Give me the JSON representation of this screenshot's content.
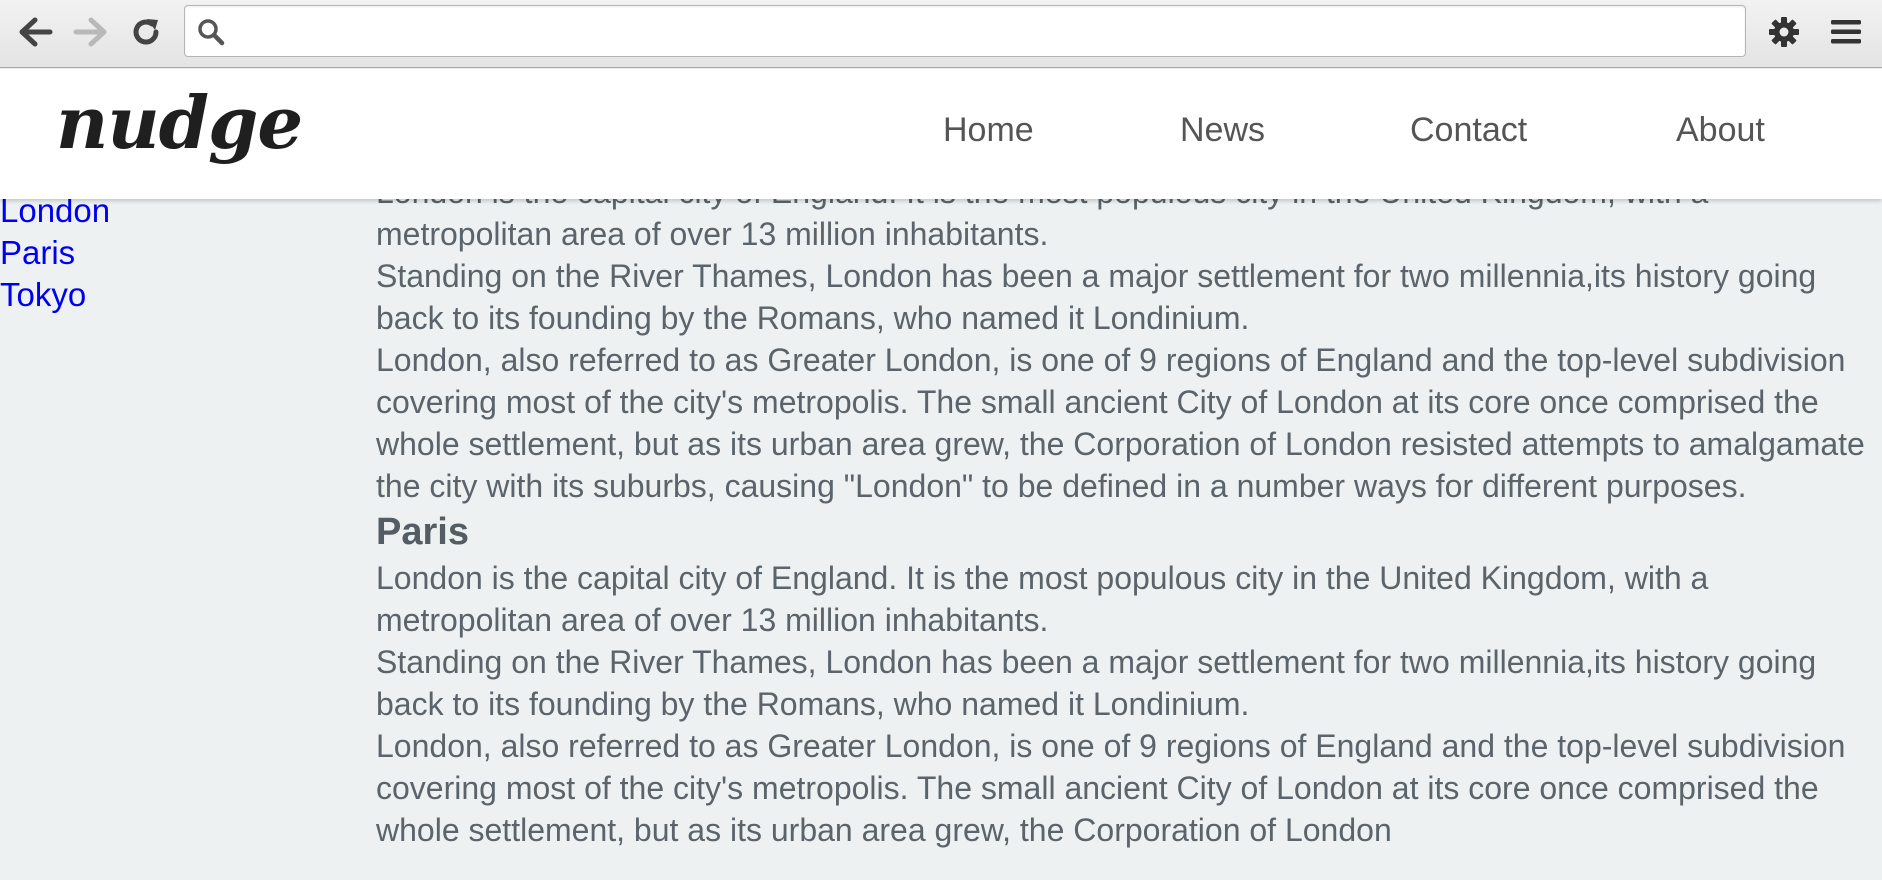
{
  "browser": {
    "address_value": "",
    "address_placeholder": ""
  },
  "header": {
    "logo": "nudge",
    "nav": [
      "Home",
      "News",
      "Contact",
      "About"
    ]
  },
  "sidebar": {
    "links": [
      "London",
      "Paris",
      "Tokyo"
    ]
  },
  "content": {
    "top_partial": "London is the capital city of England. It is the most populous city in the United Kingdom, with a",
    "p1_end": "metropolitan area of over 13 million inhabitants.",
    "p2": "Standing on the River Thames, London has been a major settlement for two millennia,its history going back to its founding by the Romans, who named it Londinium.",
    "p3": "London, also referred to as Greater London, is one of 9 regions of England and the top-level subdivision covering most of the city's metropolis. The small ancient City of London at its core once comprised the whole settlement, but as its urban area grew, the Corporation of London resisted attempts to amalgamate the city with its suburbs, causing \"London\" to be defined in a number ways for different purposes.",
    "section2_title": "Paris",
    "s2_p1": "London is the capital city of England. It is the most populous city in the United Kingdom, with a metropolitan area of over 13 million inhabitants.",
    "s2_p2": "Standing on the River Thames, London has been a major settlement for two millennia,its history going back to its founding by the Romans, who named it Londinium.",
    "s2_p3": "London, also referred to as Greater London, is one of 9 regions of England and the top-level subdivision covering most of the city's metropolis. The small ancient City of London at its core once comprised the whole settlement, but as its urban area grew, the Corporation of London"
  },
  "colors": {
    "link": "#0000ee",
    "body_text": "#5a646a",
    "page_bg": "#edf1f2"
  }
}
